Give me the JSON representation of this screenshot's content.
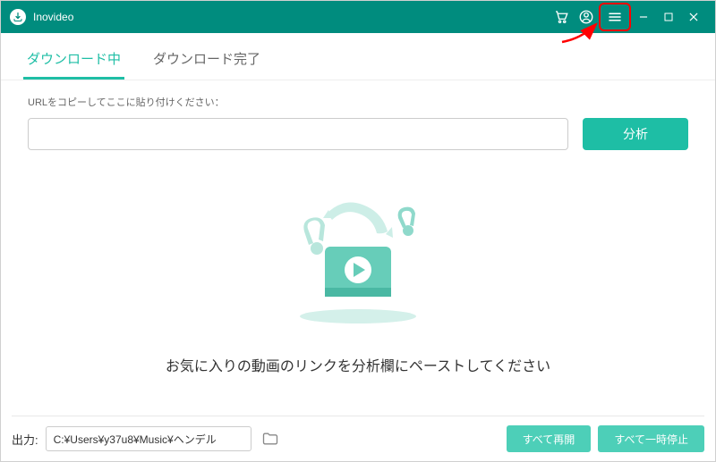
{
  "app": {
    "title": "Inovideo"
  },
  "tabs": {
    "downloading": "ダウンロード中",
    "completed": "ダウンロード完了"
  },
  "url_section": {
    "label": "URLをコピーしてここに貼り付けください：",
    "analyze": "分析"
  },
  "empty_state": {
    "message": "お気に入りの動画のリンクを分析欄にペーストしてください"
  },
  "footer": {
    "output_label": "出力:",
    "output_path": "C:¥Users¥y37u8¥Music¥ヘンデル",
    "resume_all": "すべて再開",
    "pause_all": "すべて一時停止"
  }
}
